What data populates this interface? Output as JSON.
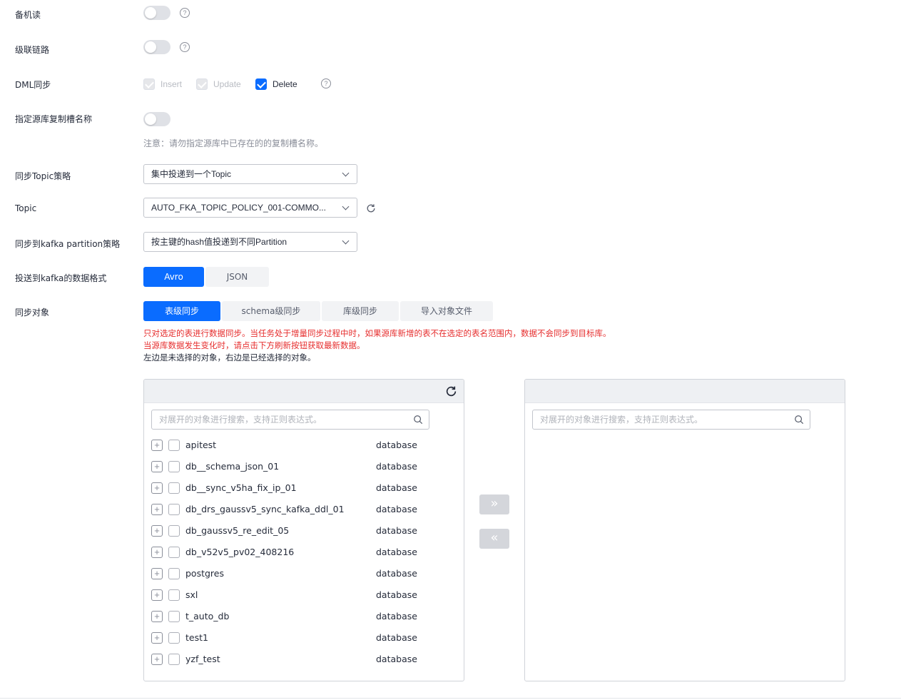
{
  "standby_read": {
    "label": "备机读",
    "enabled": false
  },
  "cascade_link": {
    "label": "级联链路",
    "enabled": false
  },
  "dml_sync": {
    "label": "DML同步",
    "options": [
      {
        "label": "Insert",
        "checked": true,
        "disabled": true
      },
      {
        "label": "Update",
        "checked": true,
        "disabled": true
      },
      {
        "label": "Delete",
        "checked": true,
        "disabled": false
      }
    ]
  },
  "slot_name": {
    "label": "指定源库复制槽名称",
    "enabled": false,
    "note": "注意：请勿指定源库中已存在的的复制槽名称。"
  },
  "topic_policy": {
    "label": "同步Topic策略",
    "value": "集中投递到一个Topic"
  },
  "topic": {
    "label": "Topic",
    "value": "AUTO_FKA_TOPIC_POLICY_001-COMMO..."
  },
  "partition_policy": {
    "label": "同步到kafka partition策略",
    "value": "按主键的hash值投递到不同Partition"
  },
  "data_format": {
    "label": "投送到kafka的数据格式",
    "options": [
      "Avro",
      "JSON"
    ],
    "selected": "Avro"
  },
  "sync_object": {
    "label": "同步对象",
    "tabs": [
      "表级同步",
      "schema级同步",
      "库级同步",
      "导入对象文件"
    ],
    "selected": "表级同步",
    "warning_line1": "只对选定的表进行数据同步。当任务处于增量同步过程中时，如果源库新增的表不在选定的表名范围内，数据不会同步到目标库。",
    "warning_line2": "当源库数据发生变化时，请点击下方刷新按钮获取最新数据。",
    "info_line": "左边是未选择的对象，右边是已经选择的对象。"
  },
  "left_panel": {
    "search_placeholder": "对展开的对象进行搜索，支持正则表达式。",
    "items": [
      {
        "name": "apitest",
        "type": "database"
      },
      {
        "name": "db__schema_json_01",
        "type": "database"
      },
      {
        "name": "db__sync_v5ha_fix_ip_01",
        "type": "database"
      },
      {
        "name": "db_drs_gaussv5_sync_kafka_ddl_01",
        "type": "database"
      },
      {
        "name": "db_gaussv5_re_edit_05",
        "type": "database"
      },
      {
        "name": "db_v52v5_pv02_408216",
        "type": "database"
      },
      {
        "name": "postgres",
        "type": "database"
      },
      {
        "name": "sxl",
        "type": "database"
      },
      {
        "name": "t_auto_db",
        "type": "database"
      },
      {
        "name": "test1",
        "type": "database"
      },
      {
        "name": "yzf_test",
        "type": "database"
      }
    ]
  },
  "right_panel": {
    "search_placeholder": "对展开的对象进行搜索，支持正则表达式。"
  },
  "transfer": {
    "move_right": "»",
    "move_left": "«"
  },
  "colors": {
    "primary": "#0a6cff",
    "warning": "#e62e2e",
    "disabled": "#d4d6db"
  }
}
